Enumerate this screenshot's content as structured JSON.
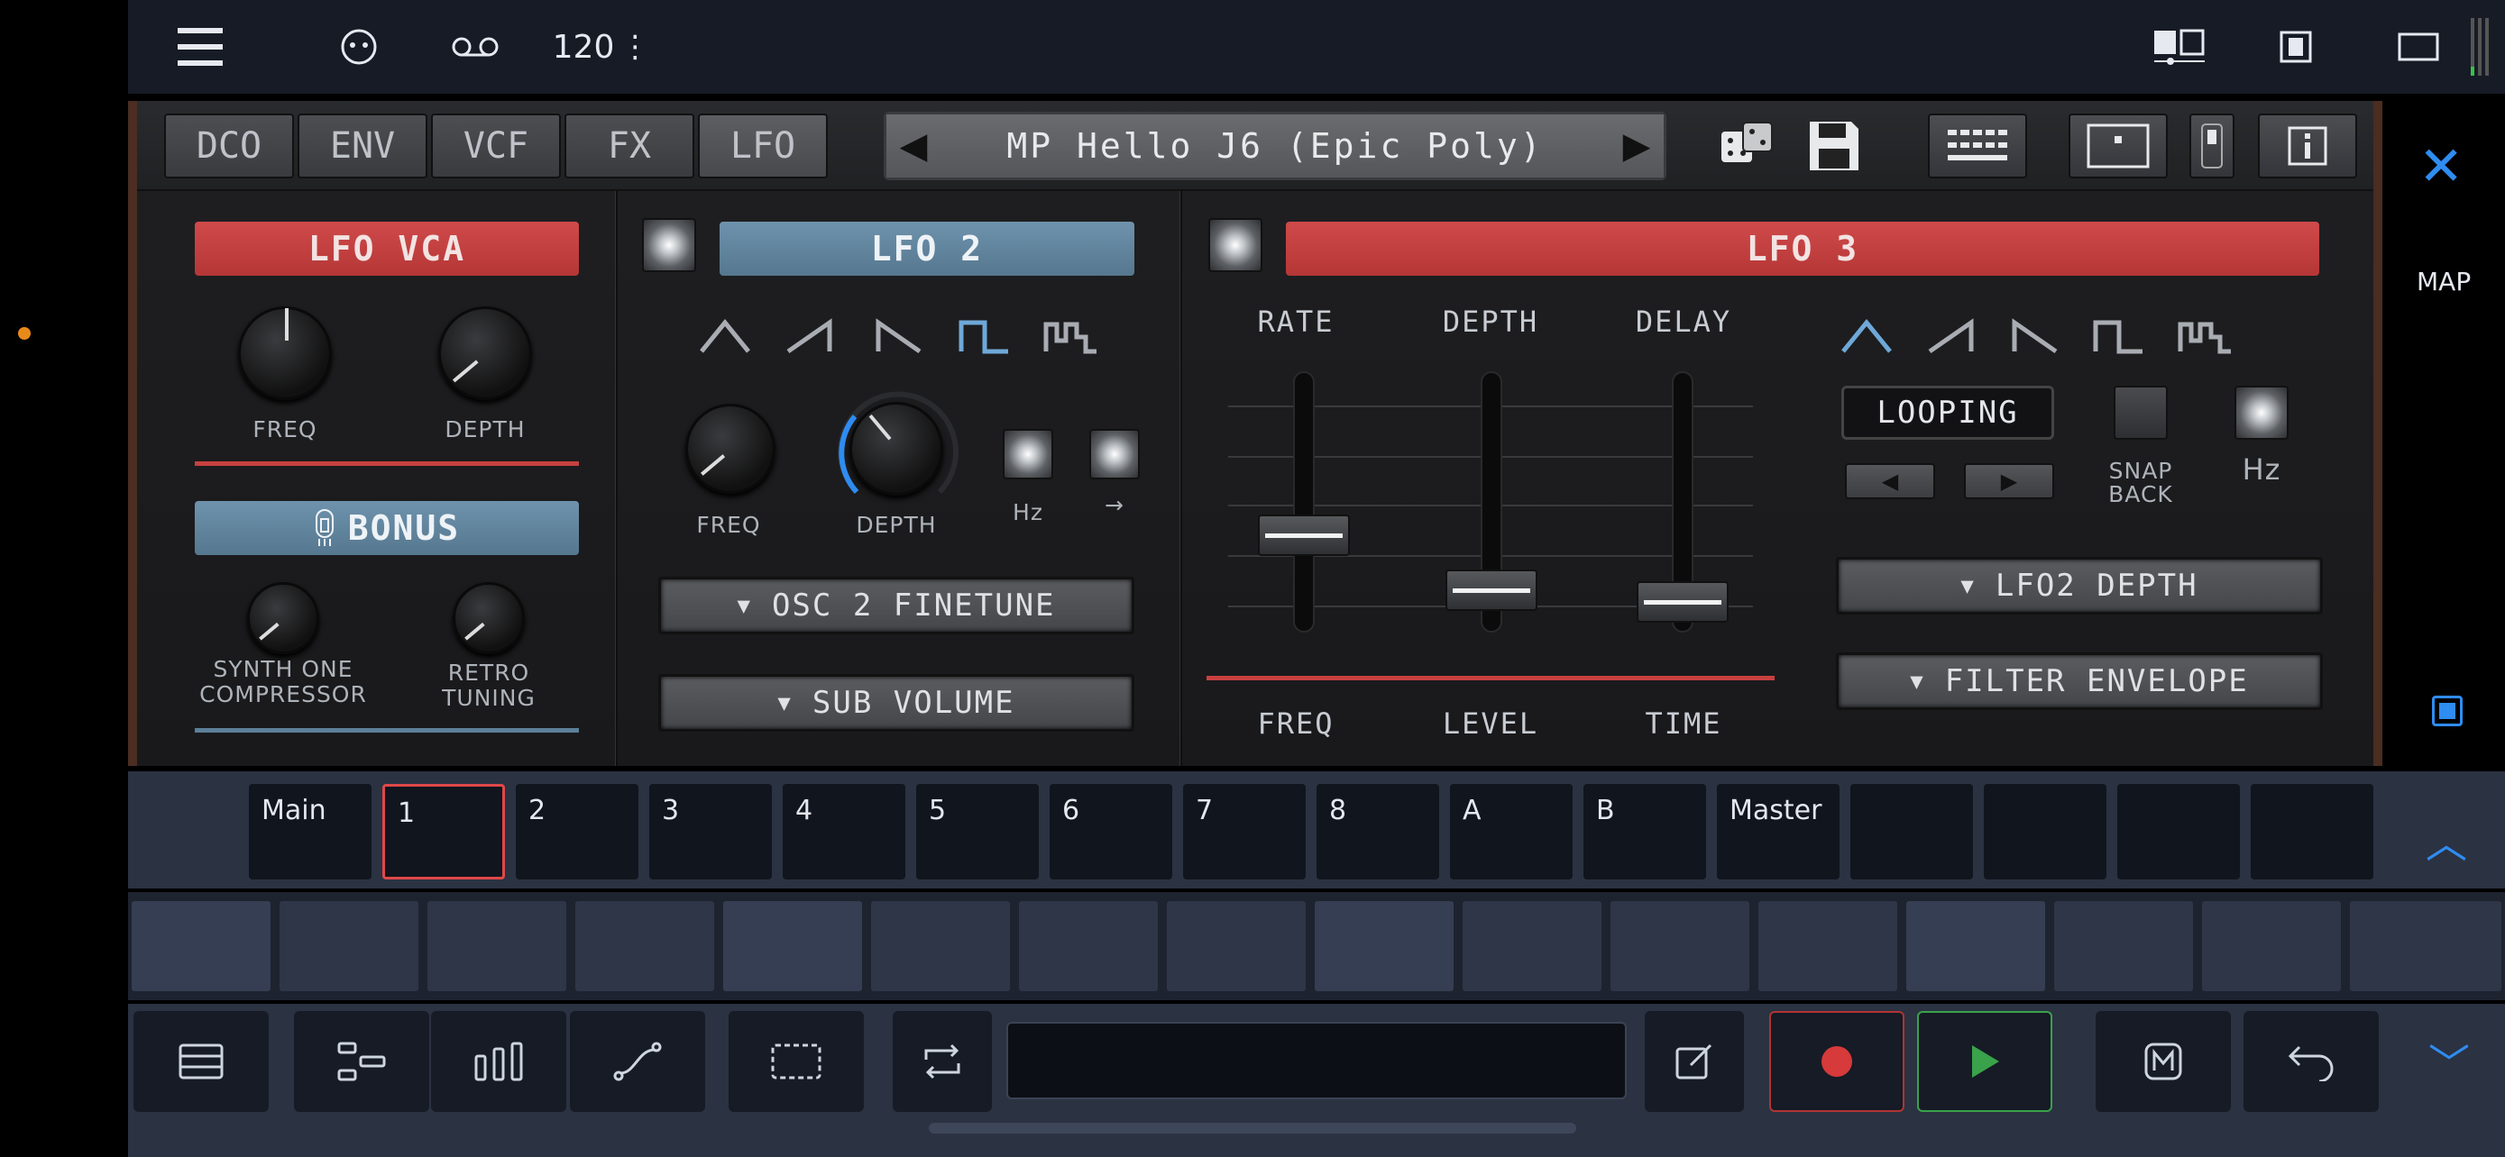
{
  "topbar": {
    "tempo": "120",
    "tempo_menu": "⋮"
  },
  "tabs": [
    {
      "label": "DCO"
    },
    {
      "label": "ENV"
    },
    {
      "label": "VCF"
    },
    {
      "label": "FX"
    },
    {
      "label": "LFO"
    }
  ],
  "preset": {
    "name": "MP Hello J6 (Epic Poly)"
  },
  "lfo_vca": {
    "title": "LFO VCA",
    "freq_label": "FREQ",
    "depth_label": "DEPTH"
  },
  "bonus": {
    "title": "BONUS",
    "compressor_label_1": "SYNTH ONE",
    "compressor_label_2": "COMPRESSOR",
    "retro_label_1": "RETRO",
    "retro_label_2": "TUNING"
  },
  "lfo2": {
    "title": "LFO 2",
    "freq_label": "FREQ",
    "depth_label": "DEPTH",
    "hz_label": "Hz",
    "arrow_label": "→",
    "dest1": "OSC 2 FINETUNE",
    "dest2": "SUB VOLUME"
  },
  "lfo3": {
    "title": "LFO 3",
    "rate_label": "RATE",
    "depth_label": "DEPTH",
    "delay_label": "DELAY",
    "freq_label": "FREQ",
    "level_label": "LEVEL",
    "time_label": "TIME",
    "looping": "LOOPING",
    "snap_label_1": "SNAP",
    "snap_label_2": "BACK",
    "hz_label": "Hz",
    "dest1": "LFO2 DEPTH",
    "dest2": "FILTER ENVELOPE",
    "sliders": {
      "rate": 0.35,
      "depth": 0.1,
      "delay": 0.05
    }
  },
  "side": {
    "map_label": "MAP"
  },
  "tracks": [
    "Main",
    "1",
    "2",
    "3",
    "4",
    "5",
    "6",
    "7",
    "8",
    "A",
    "B",
    "Master",
    "",
    "",
    "",
    ""
  ],
  "selected_track": "1",
  "colors": {
    "accent_blue": "#2f8cf0",
    "lfo_red": "#c84040",
    "lfo_blue": "#5c7f99",
    "record_red": "#d63a3a",
    "play_green": "#3aa24a"
  }
}
